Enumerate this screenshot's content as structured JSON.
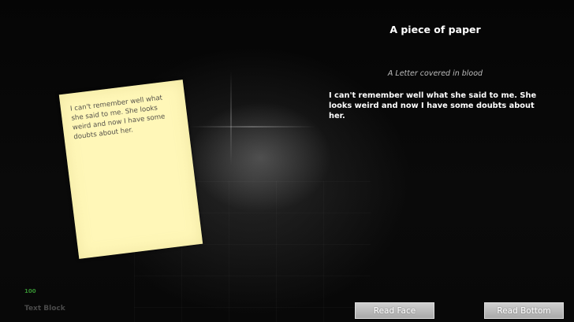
{
  "item": {
    "title": "A piece of paper",
    "subtitle": "A Letter covered in blood",
    "description": "I can't remember well what she said to me. She looks weird  and now I have some doubts  about her.",
    "paper_text": "I can't remember well what she said to me. She looks weird and now I have some doubts about her."
  },
  "buttons": {
    "read_face": "Read Face",
    "read_bottom": "Read Bottom"
  },
  "debug": {
    "fps": "100",
    "label": "Text Block"
  },
  "colors": {
    "paper": "#fff7b8",
    "button": "#b9b9b9",
    "debug_green": "#3ea83a"
  }
}
